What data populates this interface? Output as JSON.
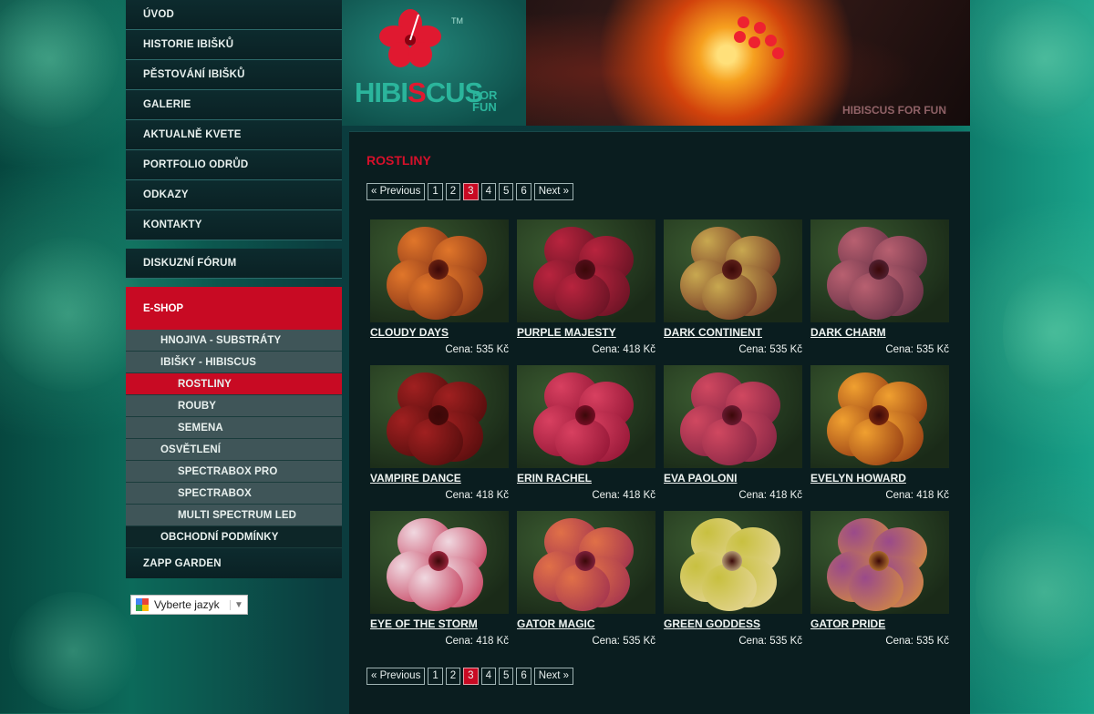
{
  "nav": {
    "items": [
      "ÚVOD",
      "HISTORIE IBIŠKŮ",
      "PĚSTOVÁNÍ IBIŠKŮ",
      "GALERIE",
      "AKTUALNĚ KVETE",
      "PORTFOLIO ODRŮD",
      "ODKAZY",
      "KONTAKTY"
    ],
    "forum": "DISKUZNÍ FÓRUM",
    "eshop": "E-SHOP",
    "sub": {
      "hnojiva": "HNOJIVA - SUBSTRÁTY",
      "ibisky": "IBIŠKY - HIBISCUS",
      "rostliny": "ROSTLINY",
      "rouby": "ROUBY",
      "semena": "SEMENA",
      "osvetleni": "OSVĚTLENÍ",
      "spectrabox_pro": "SPECTRABOX PRO",
      "spectrabox": "SPECTRABOX",
      "multi": "MULTI SPECTRUM LED",
      "podminky": "OBCHODNÍ PODMÍNKY"
    },
    "zapp": "ZAPP GARDEN"
  },
  "language": {
    "label": "Vyberte jazyk",
    "arrow": "▼"
  },
  "logo": {
    "text_a": "HIBI",
    "text_b": "S",
    "text_c": "CUS",
    "for": "FOR",
    "fun": "FUN",
    "tm": "TM"
  },
  "banner": {
    "watermark": "HIBISCUS FOR FUN"
  },
  "page_title": "ROSTLINY",
  "pager": {
    "prev": "« Previous",
    "pages": [
      "1",
      "2",
      "3",
      "4",
      "5",
      "6"
    ],
    "current": "3",
    "next": "Next »"
  },
  "products": [
    {
      "name": "CLOUDY DAYS",
      "price": "Cena: 535 Kč",
      "c1": "#e0762a",
      "c2": "#7a2a14"
    },
    {
      "name": "PURPLE MAJESTY",
      "price": "Cena: 418 Kč",
      "c1": "#b8243e",
      "c2": "#5c1020"
    },
    {
      "name": "DARK CONTINENT",
      "price": "Cena: 535 Kč",
      "c1": "#c8a850",
      "c2": "#6a2a20"
    },
    {
      "name": "DARK CHARM",
      "price": "Cena: 535 Kč",
      "c1": "#b86070",
      "c2": "#5a2a40"
    },
    {
      "name": "VAMPIRE DANCE",
      "price": "Cena: 418 Kč",
      "c1": "#a02020",
      "c2": "#4a0a0a"
    },
    {
      "name": "ERIN RACHEL",
      "price": "Cena: 418 Kč",
      "c1": "#d84060",
      "c2": "#8a1030"
    },
    {
      "name": "EVA PAOLONI",
      "price": "Cena: 418 Kč",
      "c1": "#d04860",
      "c2": "#7a2040"
    },
    {
      "name": "EVELYN HOWARD",
      "price": "Cena: 418 Kč",
      "c1": "#f0a030",
      "c2": "#8a3010"
    },
    {
      "name": "EYE OF THE STORM",
      "price": "Cena: 418 Kč",
      "c1": "#f0d8e0",
      "c2": "#c03050"
    },
    {
      "name": "GATOR MAGIC",
      "price": "Cena: 535 Kč",
      "c1": "#e07048",
      "c2": "#9a2a50"
    },
    {
      "name": "GREEN GODDESS",
      "price": "Cena: 535 Kč",
      "c1": "#c8c040",
      "c2": "#e8d8a0"
    },
    {
      "name": "GATOR PRIDE",
      "price": "Cena: 535 Kč",
      "c1": "#9a4a8a",
      "c2": "#d8903a"
    }
  ],
  "colors": {
    "accent": "#c80a23",
    "sidebar": "#0d2b2e",
    "submenu": "#3f5558"
  }
}
